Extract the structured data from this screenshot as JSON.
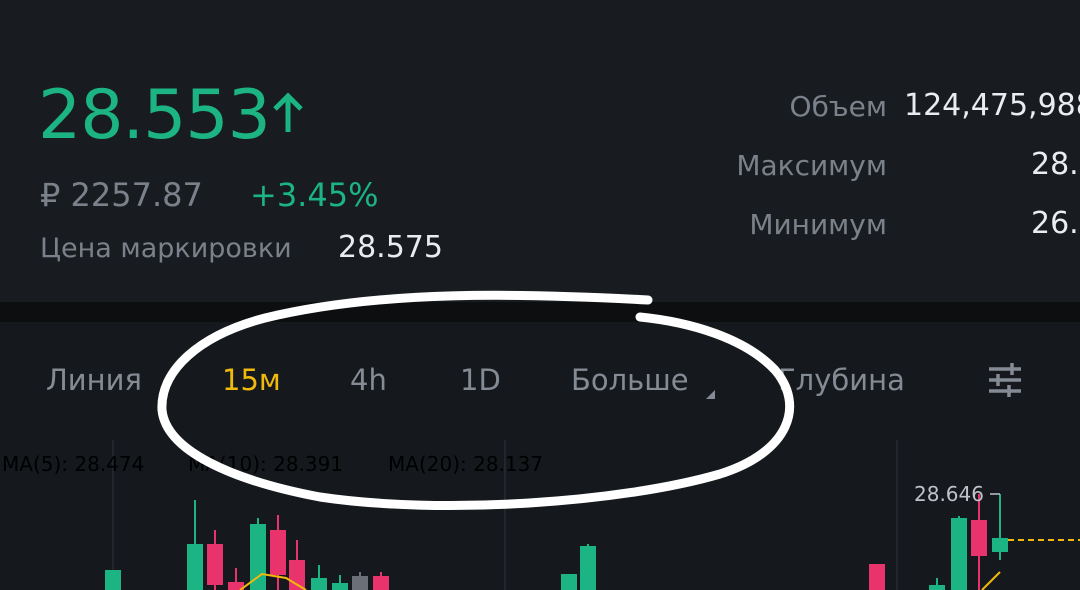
{
  "ticker": {
    "last_price": "28.553",
    "last_price_direction": "up",
    "fiat_price": "₽ 2257.87",
    "change_percent": "+3.45%",
    "mark_price_label": "Цена маркировки",
    "mark_price_value": "28.575",
    "up_color": "#1cb482",
    "down_color": "#e8336d"
  },
  "stats": {
    "volume_label": "Объем",
    "volume_value": "124,475,988",
    "high_label": "Максимум",
    "high_value": "28.",
    "low_label": "Минимум",
    "low_value": "26."
  },
  "chart_tabs": {
    "items": [
      "Линия",
      "15м",
      "4h",
      "1D",
      "Больше",
      "Глубина"
    ],
    "active_index": 1,
    "active_color": "#f0b90b",
    "more_has_dropdown": true,
    "settings_icon": "settings-sliders-icon"
  },
  "indicators": {
    "ma5": "MA(5): 28.474",
    "ma10": "MA(10): 28.391",
    "ma20": "MA(20): 28.137",
    "ma5_color": "#f0b90b",
    "ma10_color": "#e8336d",
    "ma20_color": "#9c6ade"
  },
  "chart": {
    "peak_label": "28.646",
    "current_price_line_color": "#f0b90b"
  }
}
